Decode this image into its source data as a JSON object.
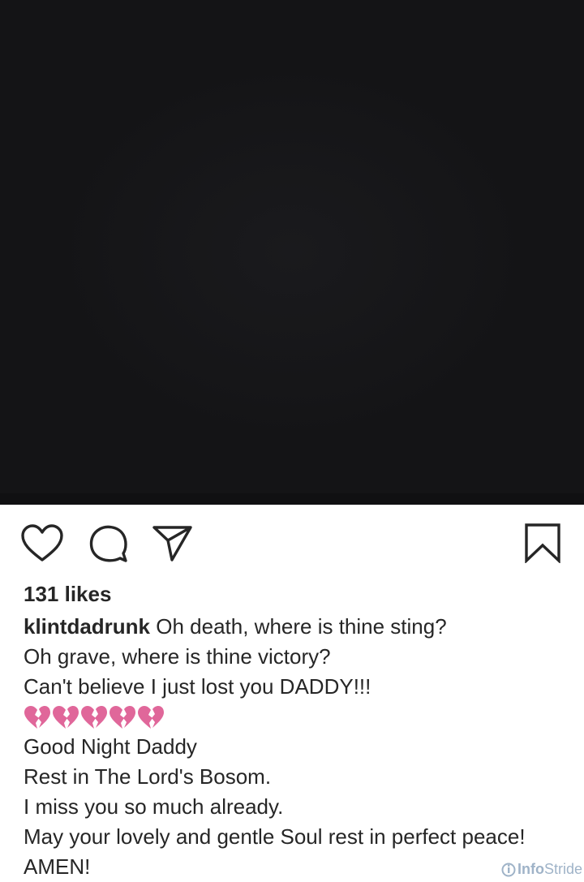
{
  "post": {
    "likes": "131 likes",
    "username": "klintdadrunk",
    "caption_first": "Oh death, where is thine sting?",
    "caption_lines": [
      "Oh grave, where is thine victory?",
      "Can't believe I just lost you DADDY!!!"
    ],
    "emoji": [
      "broken-heart",
      "broken-heart",
      "broken-heart",
      "broken-heart",
      "broken-heart"
    ],
    "caption_lines_after": [
      "Good Night Daddy",
      "Rest in The Lord's Bosom.",
      "I miss you so much already.",
      "May your lovely and gentle Soul rest in perfect peace!",
      "AMEN!"
    ]
  },
  "actions": {
    "icons": [
      "heart-icon",
      "comment-icon",
      "share-icon",
      "bookmark-icon"
    ]
  },
  "watermark": {
    "text_a": "Info",
    "text_b": "Stride"
  },
  "colors": {
    "media_bg": "#141416",
    "text": "#262626",
    "broken_heart": "#e0679a"
  }
}
